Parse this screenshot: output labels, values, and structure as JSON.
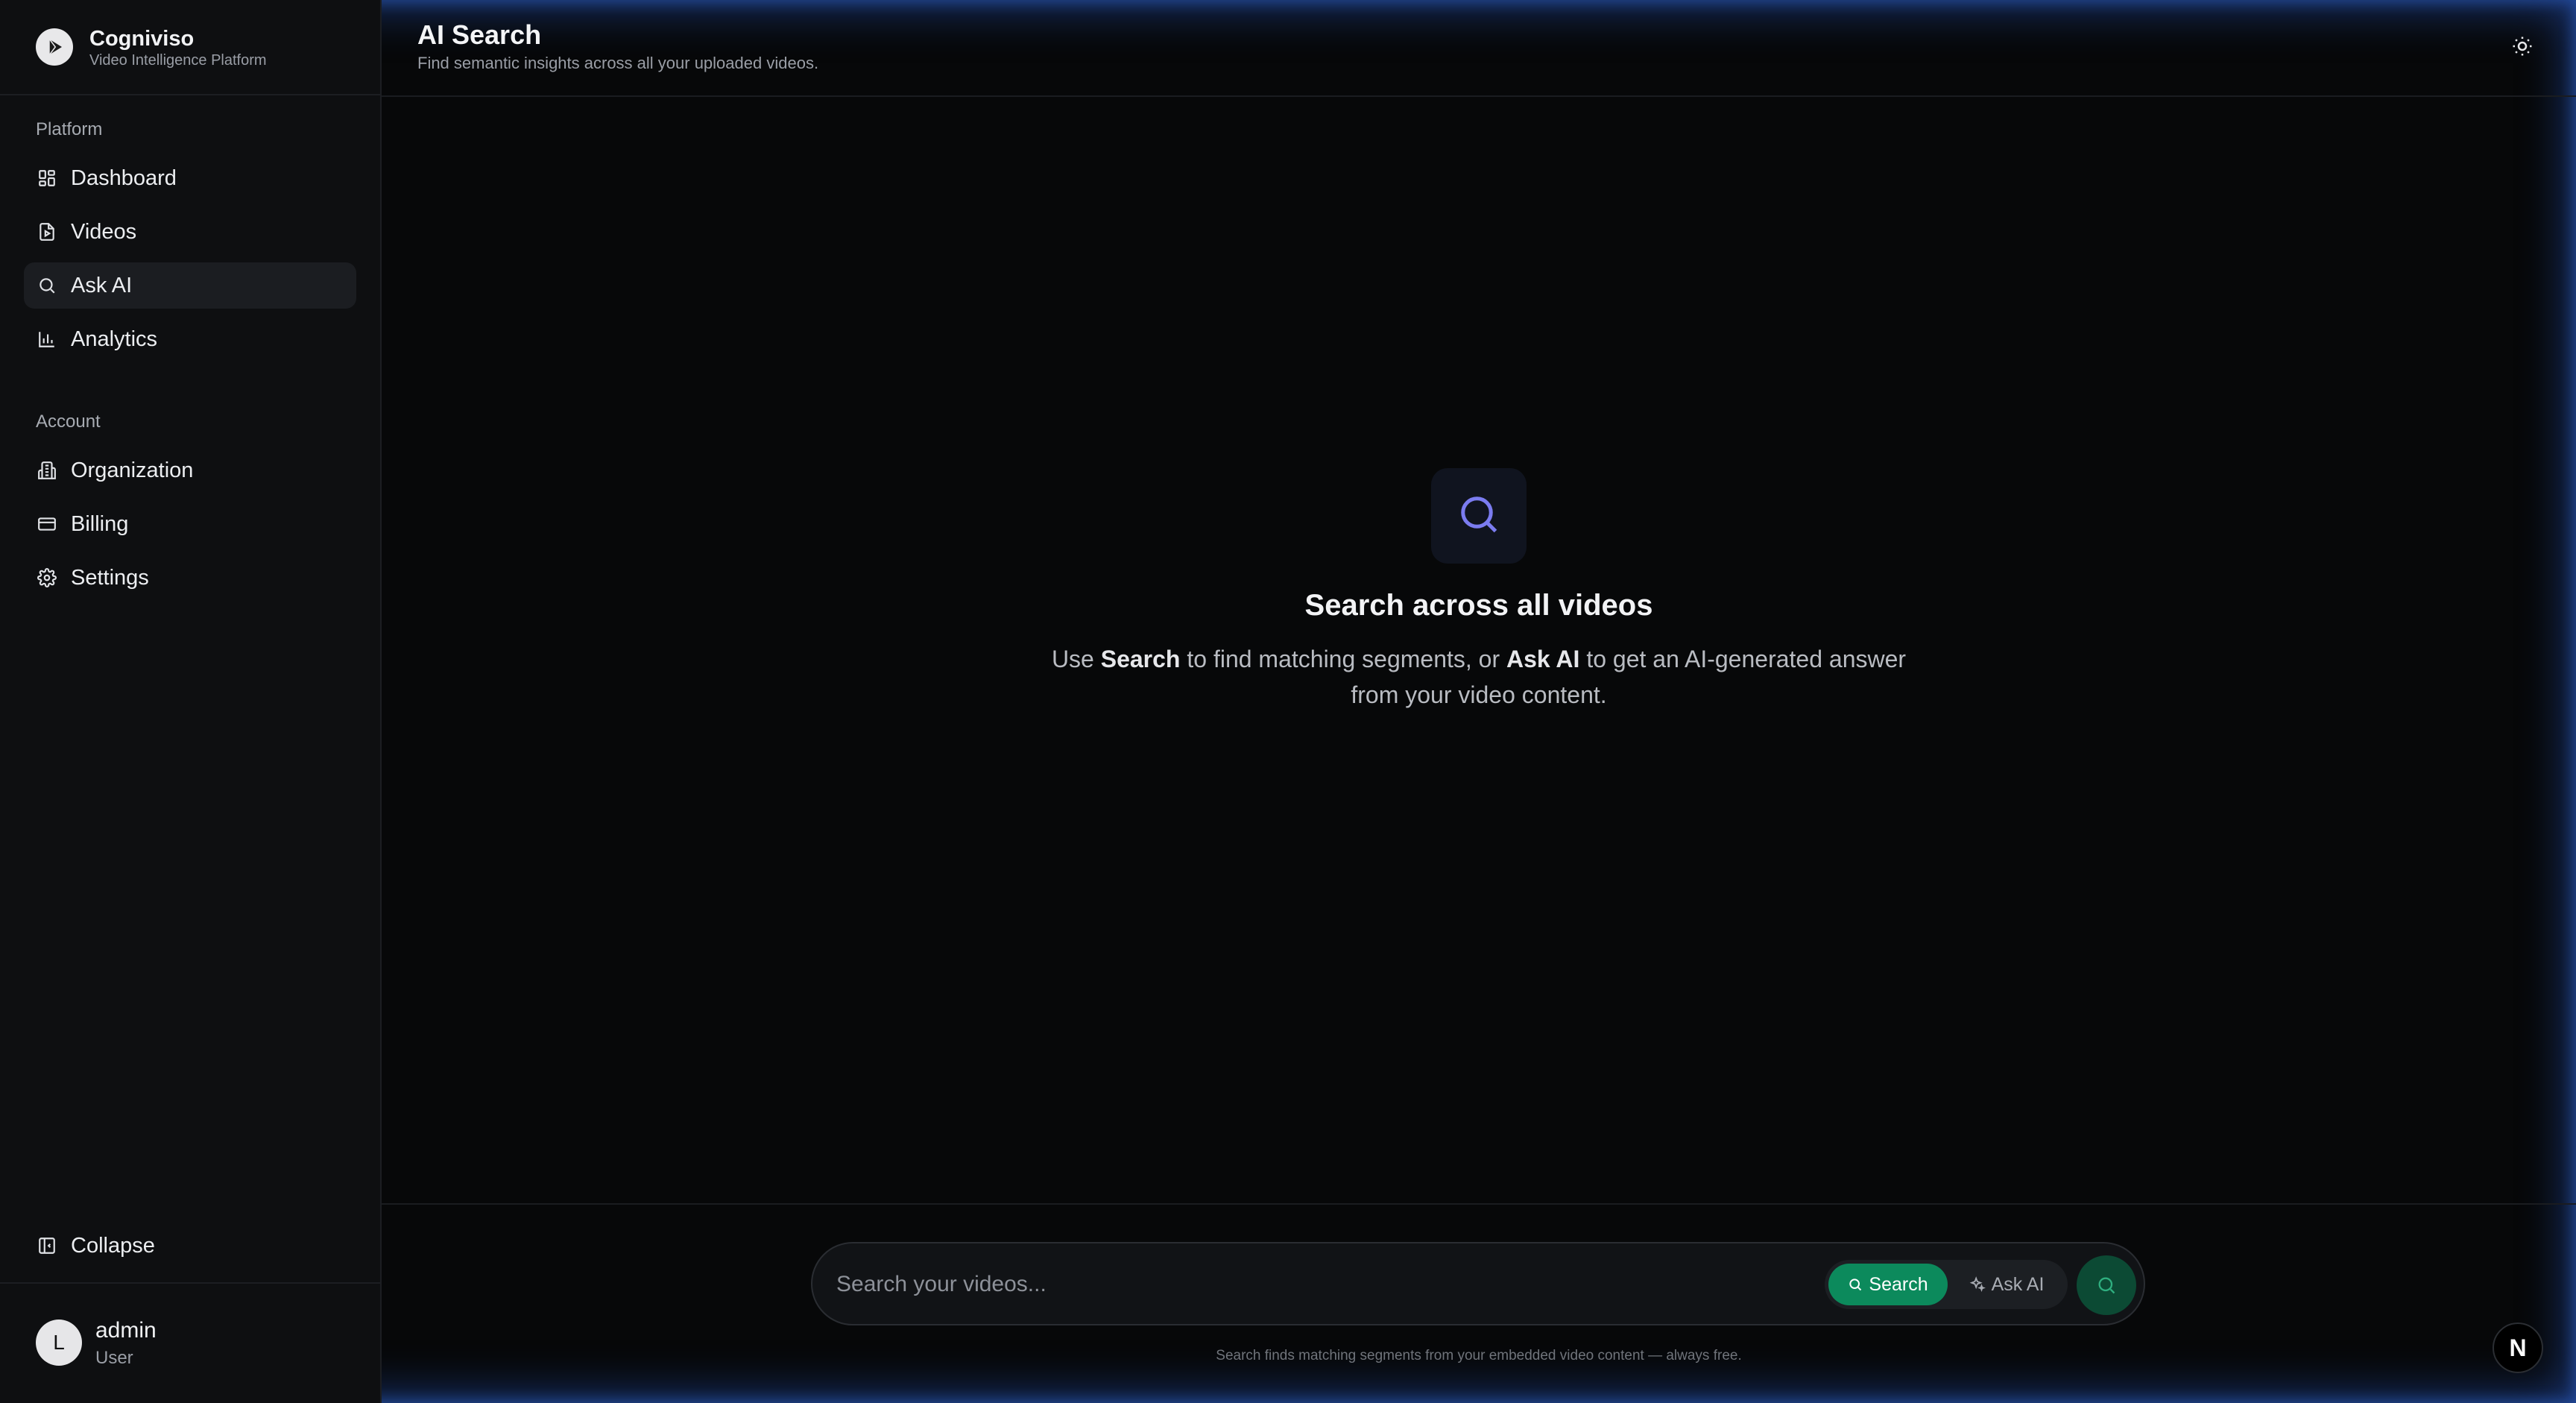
{
  "brand": {
    "title": "Cogniviso",
    "subtitle": "Video Intelligence Platform"
  },
  "sidebar": {
    "platform_label": "Platform",
    "platform_items": [
      {
        "label": "Dashboard",
        "icon": "dashboard-grid-icon"
      },
      {
        "label": "Videos",
        "icon": "video-file-icon"
      },
      {
        "label": "Ask AI",
        "icon": "search-icon",
        "active": true
      },
      {
        "label": "Analytics",
        "icon": "bar-chart-icon"
      }
    ],
    "account_label": "Account",
    "account_items": [
      {
        "label": "Organization",
        "icon": "building-icon"
      },
      {
        "label": "Billing",
        "icon": "credit-card-icon"
      },
      {
        "label": "Settings",
        "icon": "gear-icon"
      }
    ],
    "collapse_label": "Collapse"
  },
  "user": {
    "initial": "L",
    "name": "admin",
    "role": "User"
  },
  "header": {
    "title": "AI Search",
    "subtitle": "Find semantic insights across all your uploaded videos."
  },
  "empty_state": {
    "title": "Search across all videos",
    "text_1": "Use ",
    "bold_1": "Search",
    "text_2": " to find matching segments, or ",
    "bold_2": "Ask AI",
    "text_3": " to get an AI-generated answer from your video content."
  },
  "search": {
    "placeholder": "Search your videos...",
    "mode_search_label": "Search",
    "mode_ask_label": "Ask AI",
    "footer_note": "Search finds matching segments from your embedded video content — always free."
  },
  "badge": {
    "letter": "N"
  },
  "colors": {
    "accent_green": "#0c8a5c",
    "icon_purple": "#7b7cf0",
    "background": "#070809"
  }
}
